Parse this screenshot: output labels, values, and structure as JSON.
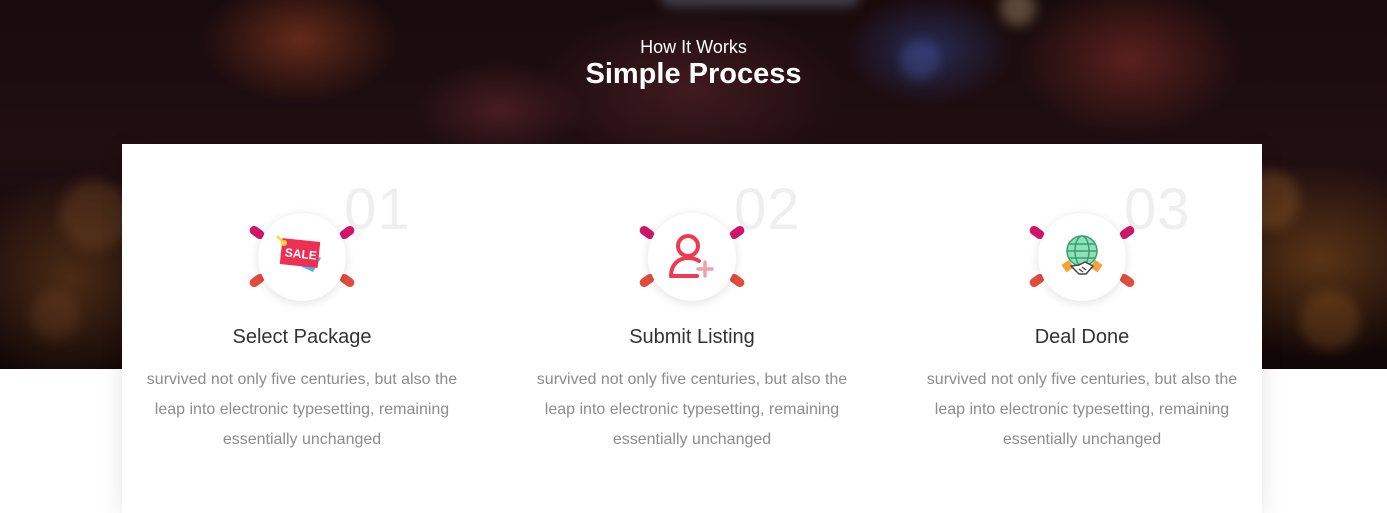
{
  "section": {
    "subtitle": "How It Works",
    "title": "Simple Process"
  },
  "colors": {
    "accent_pink": "#d1156b",
    "accent_red": "#e24c3e",
    "number_gray": "#efefef"
  },
  "steps": [
    {
      "number": "01",
      "icon": "sale-tag-icon",
      "icon_text": "SALE",
      "title": "Select Package",
      "description": "survived not only five centuries, but also the leap into electronic typesetting, remaining essentially unchanged"
    },
    {
      "number": "02",
      "icon": "add-user-icon",
      "title": "Submit Listing",
      "description": "survived not only five centuries, but also the leap into electronic typesetting, remaining essentially unchanged"
    },
    {
      "number": "03",
      "icon": "globe-handshake-icon",
      "title": "Deal Done",
      "description": "survived not only five centuries, but also the leap into electronic typesetting, remaining essentially unchanged"
    }
  ]
}
